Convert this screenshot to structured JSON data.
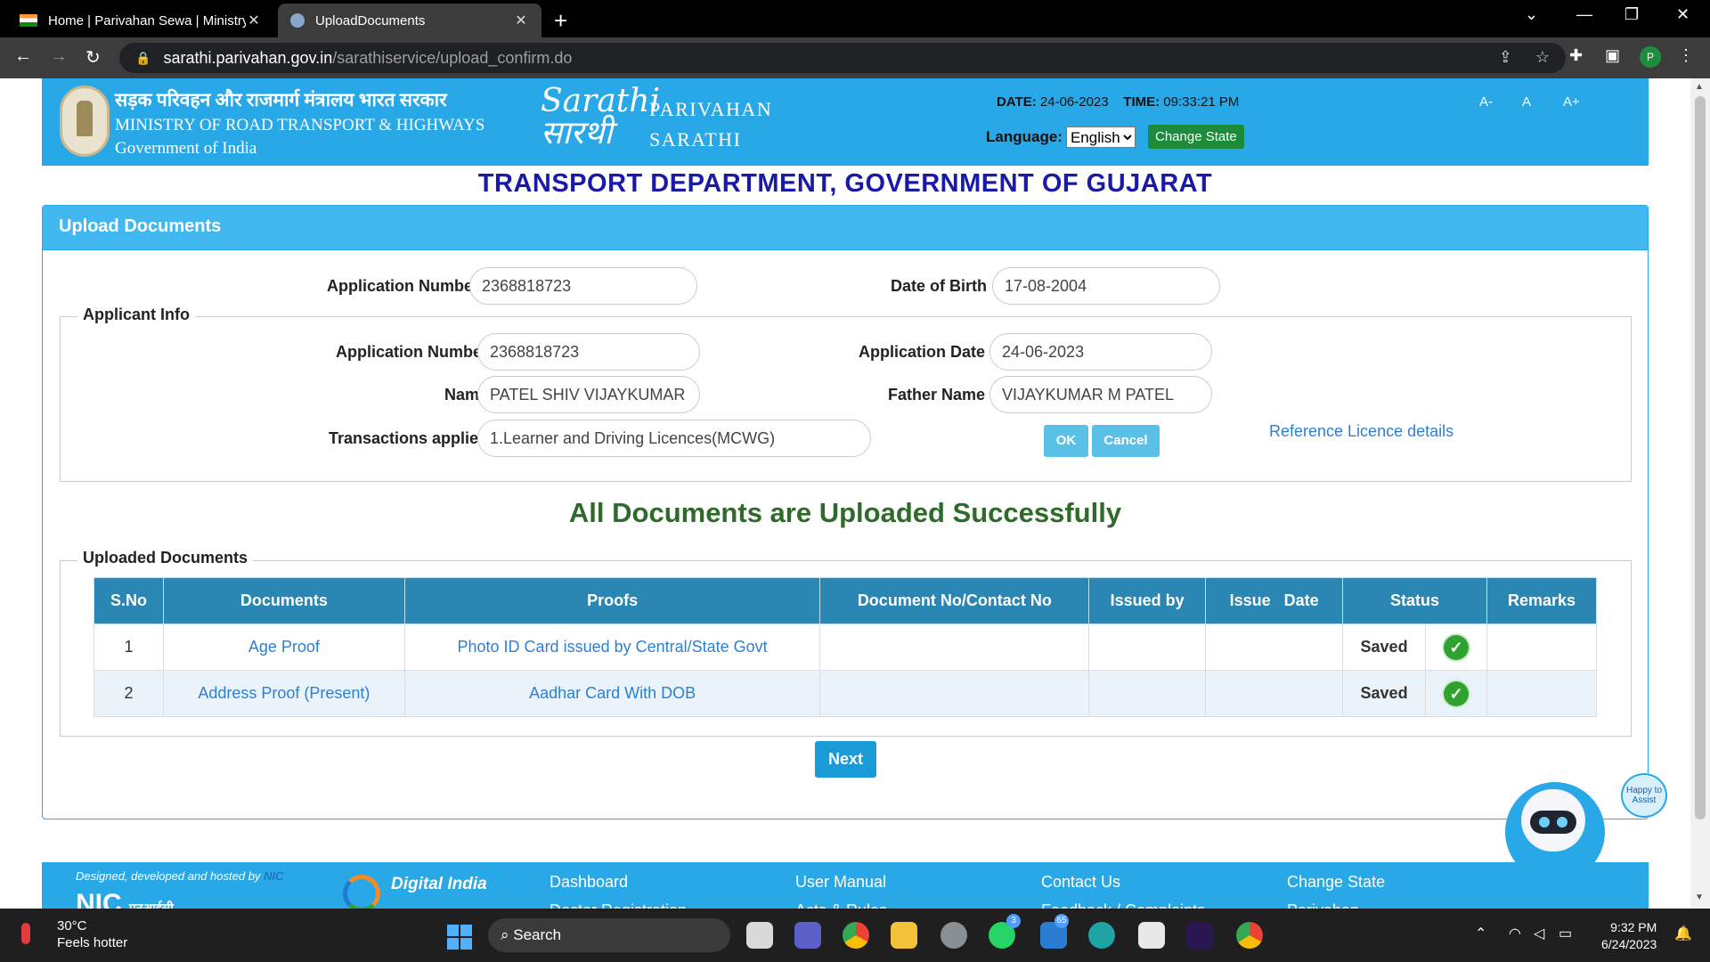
{
  "browser": {
    "tabs": [
      {
        "title": "Home | Parivahan Sewa | Ministry"
      },
      {
        "title": "UploadDocuments"
      }
    ],
    "url_host": "sarathi.parivahan.gov.in",
    "url_path": "/sarathiservice/upload_confirm.do",
    "profile_initial": "P"
  },
  "header": {
    "ministry_hi": "सड़क परिवहन और राजमार्ग मंत्रालय भारत सरकार",
    "ministry_en": "MINISTRY OF ROAD TRANSPORT & HIGHWAYS",
    "government": "Government of India",
    "logo_text": "Sarathi",
    "logo_sub": "सारथी",
    "parivahan": "PARIVAHAN",
    "sarathi": "SARATHI",
    "date_label": "DATE:",
    "date_value": "24-06-2023",
    "time_label": "TIME:",
    "time_value": "09:33:21 PM",
    "language_label": "Language:",
    "language_value": "English",
    "change_state": "Change State",
    "font_small": "A-",
    "font_normal": "A",
    "font_large": "A+"
  },
  "department_title": "TRANSPORT DEPARTMENT, GOVERNMENT OF GUJARAT",
  "panel": {
    "title": "Upload Documents",
    "search": {
      "app_no_label": "Application Number",
      "app_no_value": "2368818723",
      "dob_label": "Date of Birth",
      "dob_value": "17-08-2004"
    },
    "applicant": {
      "legend": "Applicant Info",
      "app_no_label": "Application Number",
      "app_no_value": "2368818723",
      "app_date_label": "Application Date",
      "app_date_value": "24-06-2023",
      "name_label": "Name",
      "name_value": "PATEL SHIV VIJAYKUMAR",
      "father_label": "Father Name",
      "father_value": "VIJAYKUMAR M PATEL",
      "trans_label": "Transactions applied",
      "trans_value": "1.Learner and Driving Licences(MCWG)",
      "ok": "OK",
      "cancel": "Cancel",
      "reference_link": "Reference Licence details"
    },
    "success_message": "All Documents are Uploaded Successfully",
    "uploaded": {
      "legend": "Uploaded Documents",
      "headers": [
        "S.No",
        "Documents",
        "Proofs",
        "Document No/Contact No",
        "Issued by",
        "Issue   Date",
        "Status",
        "Remarks"
      ],
      "rows": [
        {
          "sno": "1",
          "document": "Age Proof",
          "proof": "Photo ID Card issued by Central/State Govt",
          "doc_no": "",
          "issued_by": "",
          "issue_date": "",
          "status": "Saved",
          "remarks": ""
        },
        {
          "sno": "2",
          "document": "Address Proof (Present)",
          "proof": "Aadhar Card With DOB",
          "doc_no": "",
          "issued_by": "",
          "issue_date": "",
          "status": "Saved",
          "remarks": ""
        }
      ]
    },
    "next": "Next"
  },
  "footer": {
    "designed_by": "Designed, developed and hosted by",
    "designed_by_org": "NIC",
    "nic": "NIC",
    "nic_hi": "एनआईसी",
    "digital_india": "Digital India",
    "links_row1": [
      "Dashboard",
      "User Manual",
      "Contact Us",
      "Change State"
    ],
    "links_row2": [
      "Doctor Registration",
      "Acts & Rules",
      "Feedback / Complaints",
      "Parivahan"
    ]
  },
  "assistant_bubble": "Happy to Assist",
  "taskbar": {
    "temperature": "30°C",
    "weather_note": "Feels hotter",
    "search": "Search",
    "whatsapp_badge": "3",
    "mail_badge": "65",
    "time": "9:32 PM",
    "date": "6/24/2023"
  },
  "colors": {
    "header_blue": "#29a8e8",
    "dept_title": "#1a1aa8",
    "success_green": "#2e6b2a",
    "table_header": "#2a86b3",
    "change_state_green": "#1c8c3a",
    "link_blue": "#2f7fd1"
  }
}
